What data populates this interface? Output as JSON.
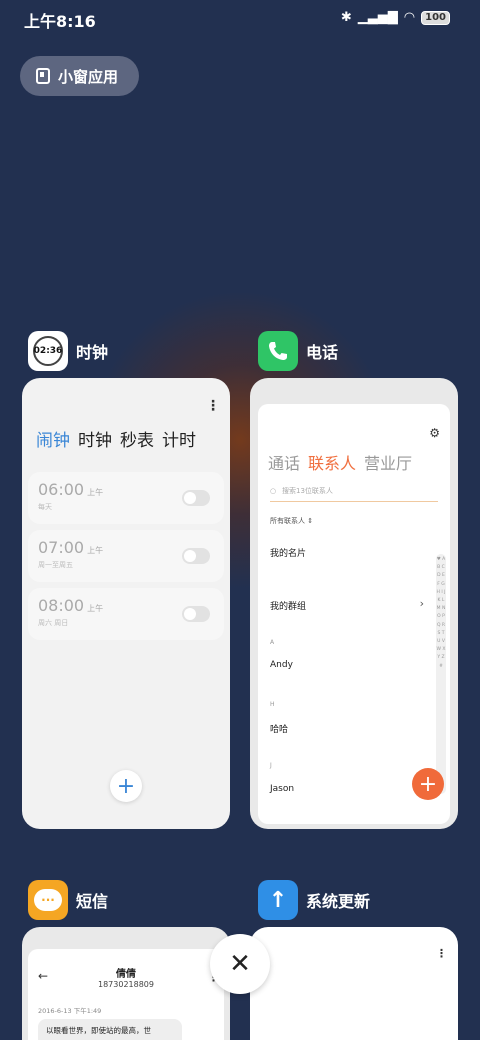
{
  "status": {
    "time": "上午8:16",
    "battery": "100"
  },
  "small_window": {
    "label": "小窗应用"
  },
  "clock_app": {
    "name": "时钟",
    "icon_text": "02:36",
    "tabs": [
      "闹钟",
      "时钟",
      "秒表",
      "计时"
    ],
    "alarms": [
      {
        "time": "06:00",
        "ampm": "上午",
        "repeat": "每天"
      },
      {
        "time": "07:00",
        "ampm": "上午",
        "repeat": "周一至周五"
      },
      {
        "time": "08:00",
        "ampm": "上午",
        "repeat": "周六 周日"
      }
    ],
    "add": "+"
  },
  "phone_app": {
    "name": "电话",
    "tabs": [
      "通话",
      "联系人",
      "营业厅"
    ],
    "search_placeholder": "搜索13位联系人",
    "all_contacts": "所有联系人 ⇕",
    "my_card": "我的名片",
    "my_groups": "我的群组",
    "sections": [
      {
        "letter": "A",
        "name": "Andy"
      },
      {
        "letter": "H",
        "name": "哈哈"
      },
      {
        "letter": "J",
        "name": "Jason"
      }
    ],
    "alphabet": "♥ A B C D E F G H I J K L M N O P Q R S T U V W X Y Z #",
    "add": "+"
  },
  "sms_app": {
    "name": "短信",
    "contact_name": "倩倩",
    "contact_number": "18730218809",
    "timestamp": "2016-6-13 下午1:49",
    "message_preview": "以眼看世界，即使站的最高，世"
  },
  "update_app": {
    "name": "系统更新"
  },
  "close_label": "✕",
  "colors": {
    "background": "#223050",
    "clock_accent": "#3a86d6",
    "phone_accent": "#f07040",
    "phone_icon_bg": "#2fc566",
    "sms_icon_bg": "#f5a623",
    "update_icon_bg": "#2f8fe6"
  }
}
